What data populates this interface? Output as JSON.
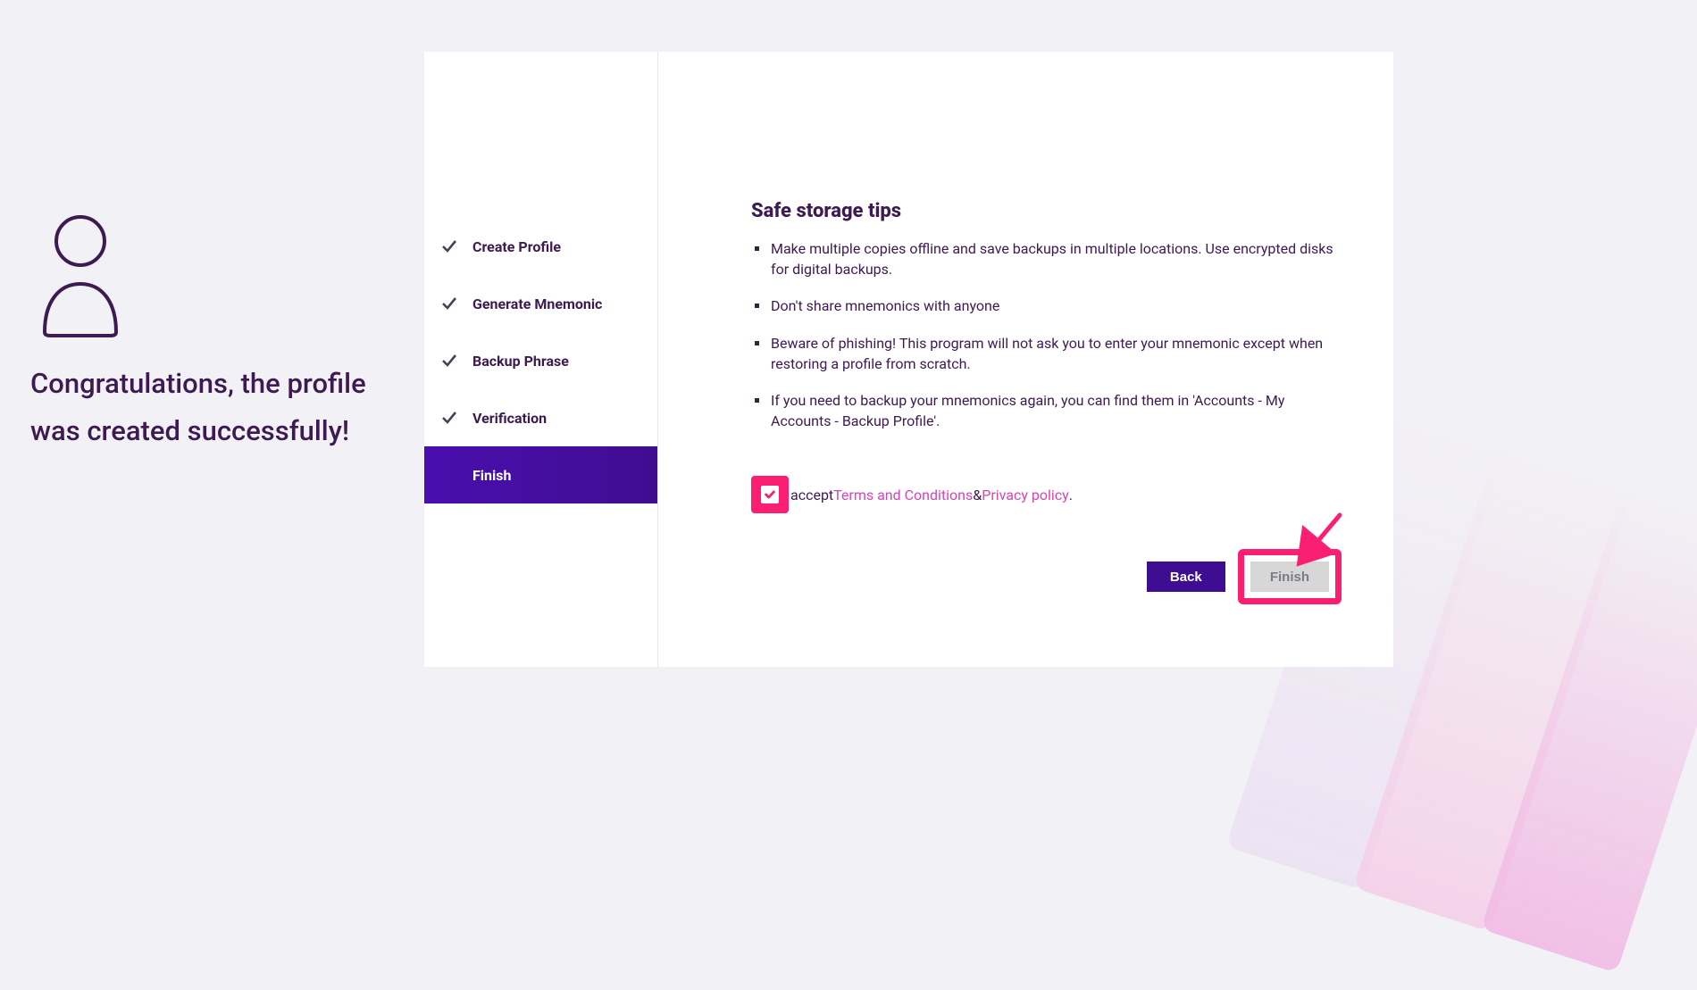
{
  "left": {
    "message": "Congratulations, the profile was created successfully!"
  },
  "steps": [
    {
      "label": "Create Profile",
      "done": true
    },
    {
      "label": "Generate Mnemonic",
      "done": true
    },
    {
      "label": "Backup Phrase",
      "done": true
    },
    {
      "label": "Verification",
      "done": true
    },
    {
      "label": "Finish",
      "active": true
    }
  ],
  "content": {
    "tips_title": "Safe storage tips",
    "tips": [
      "Make multiple copies offline and save backups in multiple locations. Use encrypted disks for digital backups.",
      "Don't share mnemonics with anyone",
      "Beware of phishing! This program will not ask you to enter your mnemonic except when restoring a profile from scratch.",
      "If you need to backup your mnemonics again, you can find them in 'Accounts - My Accounts - Backup Profile'."
    ],
    "accept_prefix": "accept ",
    "terms_link": "Terms and Conditions",
    "ampersand": " & ",
    "privacy_link": "Privacy policy",
    "period": ".",
    "back_label": "Back",
    "finish_label": "Finish"
  },
  "colors": {
    "accent_purple": "#3f0d91",
    "highlight_pink": "#fb1f73",
    "link_magenta": "#d246b5",
    "text_plum": "#3d1a52"
  }
}
